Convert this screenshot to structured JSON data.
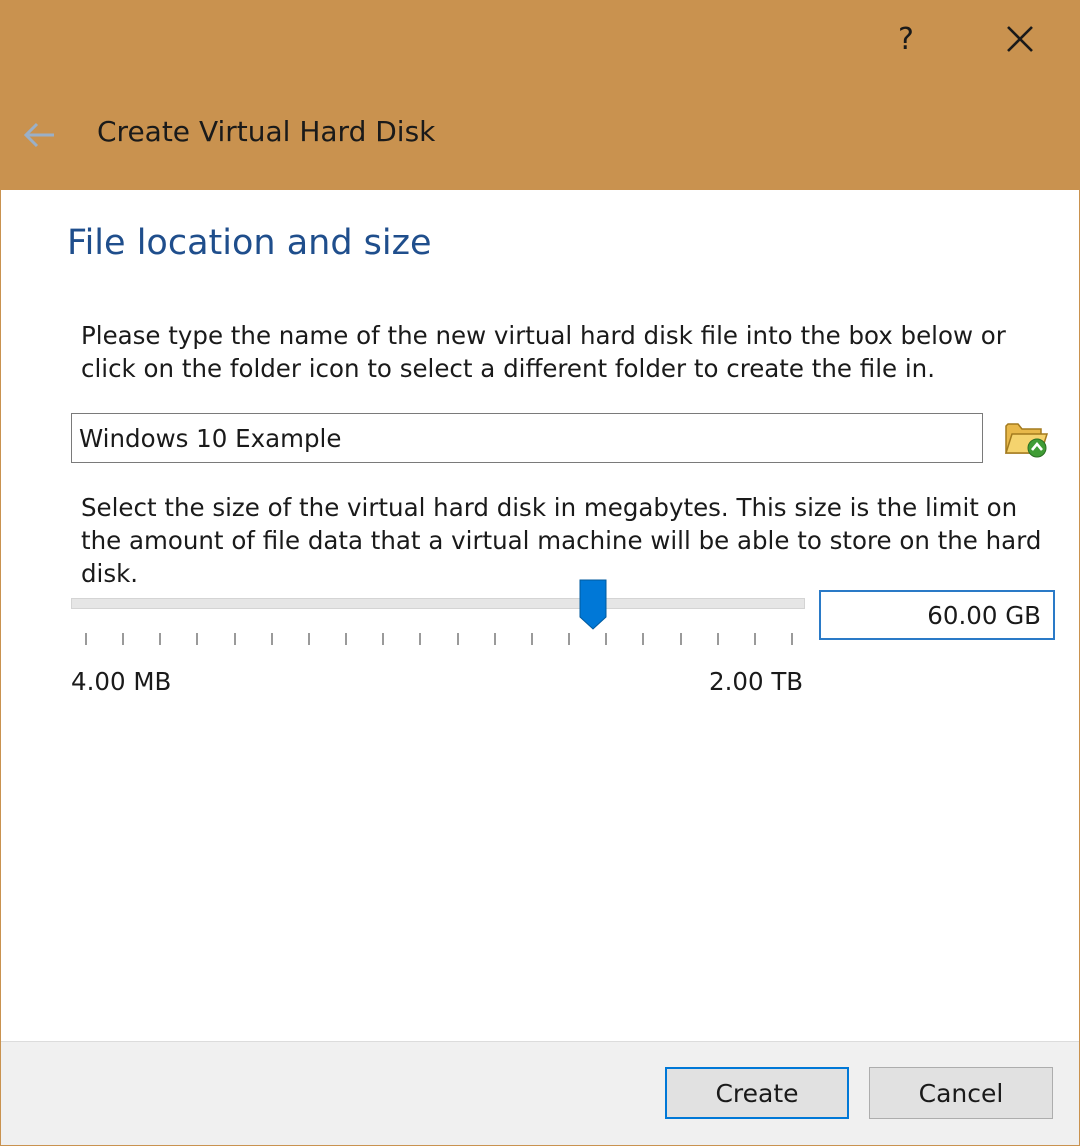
{
  "window": {
    "help_label": "?",
    "close_icon": "close-icon",
    "back_icon": "back-arrow-icon",
    "title": "Create Virtual Hard Disk"
  },
  "page": {
    "heading": "File location and size",
    "location_instructions": "Please type the name of the new virtual hard disk file into the box below or click on the folder icon to select a different folder to create the file in.",
    "file_name_value": "Windows 10 Example",
    "folder_icon": "folder-icon",
    "size_instructions": "Select the size of the virtual hard disk in megabytes. This size is the limit on the amount of file data that a virtual machine will be able to store on the hard disk.",
    "size_value": "60.00 GB",
    "slider": {
      "min_label": "4.00 MB",
      "max_label": "2.00 TB",
      "position_fraction": 0.72,
      "tick_count": 20
    }
  },
  "buttons": {
    "create": "Create",
    "cancel": "Cancel"
  },
  "colors": {
    "header": "#c9924f",
    "heading": "#1f4e8c",
    "accent": "#0078d7"
  }
}
